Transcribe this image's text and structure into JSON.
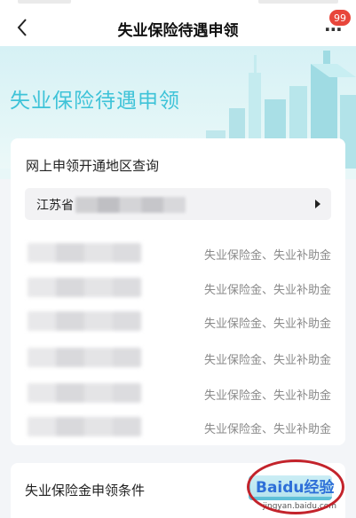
{
  "nav": {
    "title": "失业保险待遇申领",
    "badge": "99"
  },
  "banner": {
    "title": "失业保险待遇申领"
  },
  "region_card": {
    "heading": "网上申领开通地区查询",
    "province": "江苏省",
    "rows": [
      {
        "benefits": "失业保险金、失业补助金"
      },
      {
        "benefits": "失业保险金、失业补助金"
      },
      {
        "benefits": "失业保险金、失业补助金"
      },
      {
        "benefits": "失业保险金、失业补助金"
      },
      {
        "benefits": "失业保险金、失业补助金"
      },
      {
        "benefits": "失业保险金、失业补助金"
      }
    ]
  },
  "conditions_card": {
    "title": "失业保险金申领条件"
  },
  "watermark": {
    "text": "Baidu经验",
    "url": "jingyan.baidu.com"
  },
  "colors": {
    "accent": "#3ec3d8",
    "badge": "#e8463b",
    "annotation": "#c3232b"
  }
}
